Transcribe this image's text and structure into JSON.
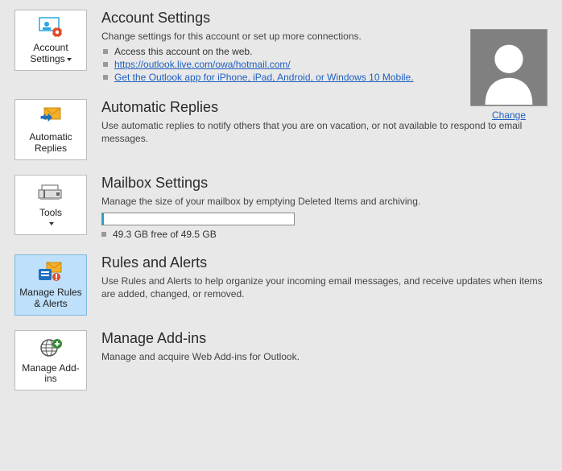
{
  "account": {
    "tile": "Account Settings",
    "heading": "Account Settings",
    "desc": "Change settings for this account or set up more connections.",
    "bullet1": "Access this account on the web.",
    "link1": "https://outlook.live.com/owa/hotmail.com/",
    "link2": "Get the Outlook app for iPhone, iPad, Android, or Windows 10 Mobile.",
    "change": "Change"
  },
  "auto": {
    "tile": "Automatic Replies",
    "heading": "Automatic Replies",
    "desc": "Use automatic replies to notify others that you are on vacation, or not available to respond to email messages."
  },
  "mailbox": {
    "tile": "Tools",
    "heading": "Mailbox Settings",
    "desc": "Manage the size of your mailbox by emptying Deleted Items and archiving.",
    "free": "49.3 GB free of 49.5 GB"
  },
  "rules": {
    "tile": "Manage Rules & Alerts",
    "heading": "Rules and Alerts",
    "desc": "Use Rules and Alerts to help organize your incoming email messages, and receive updates when items are added, changed, or removed."
  },
  "addins": {
    "tile": "Manage Add-ins",
    "heading": "Manage Add-ins",
    "desc": "Manage and acquire Web Add-ins for Outlook."
  }
}
